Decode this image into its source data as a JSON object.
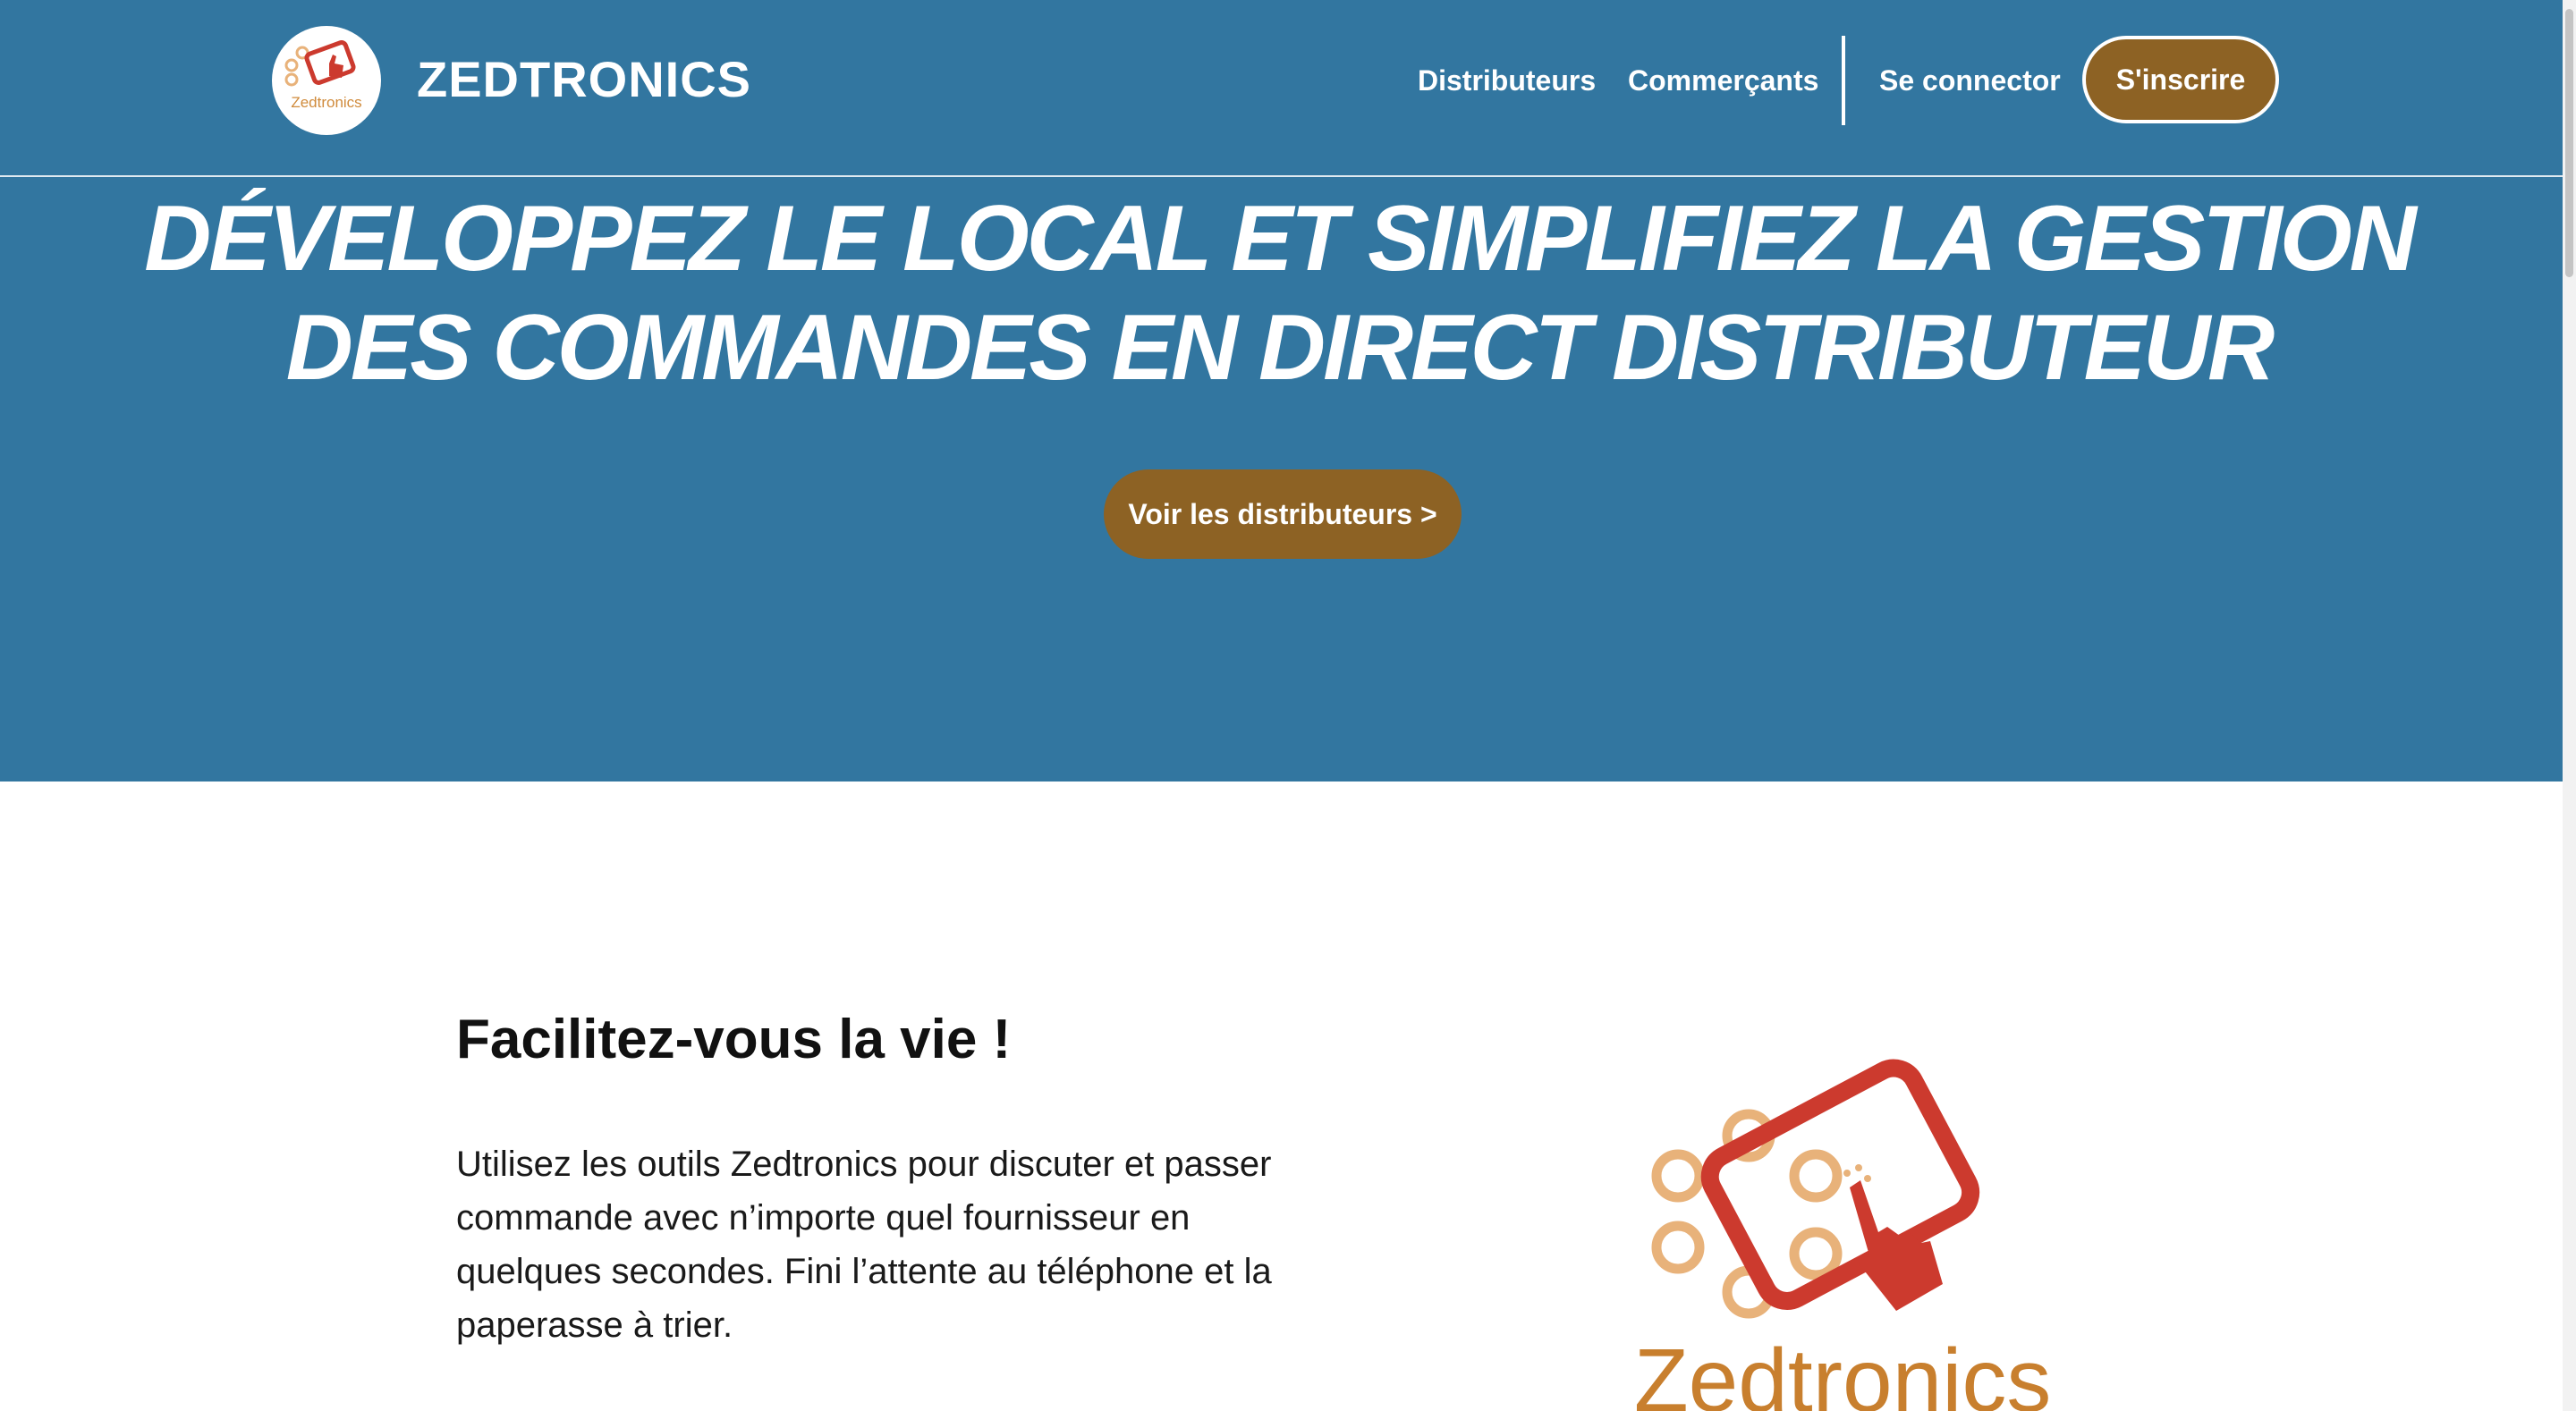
{
  "header": {
    "brand": "ZEDTRONICS",
    "logo_text": "Zedtronics",
    "nav": {
      "distributors": "Distributeurs",
      "merchants": "Commerçants",
      "login": "Se connector",
      "signup": "S'inscrire"
    }
  },
  "hero": {
    "title": "DÉVELOPPEZ LE LOCAL ET SIMPLIFIEZ LA GESTION DES COMMANDES EN DIRECT DISTRIBUTEUR",
    "cta": "Voir les distributeurs >"
  },
  "feature": {
    "title": "Facilitez-vous la vie !",
    "text": "Utilisez les outils Zedtronics pour discuter et passer commande avec n’importe quel fournisseur en quelques secondes. Fini l’attente au téléphone et la paperasse à trier.",
    "logo_text": "Zedtronics"
  },
  "colors": {
    "hero_bg": "#3276a0",
    "accent_brown": "#8d6224",
    "logo_red": "#cc3a2e",
    "logo_orange": "#e8b27a"
  },
  "icons": {
    "logo": "tablet-touch-logo",
    "big_logo": "tablet-touch-logo"
  }
}
